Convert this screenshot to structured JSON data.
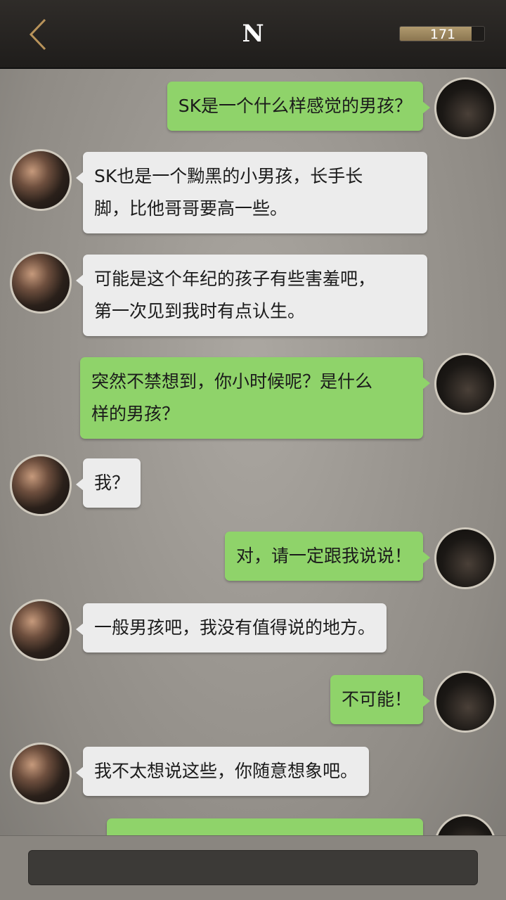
{
  "header": {
    "title": "N",
    "counter_value": "171",
    "counter_progress": 0.85,
    "back_icon": "chevron-left-icon",
    "accent_color": "#b8935a"
  },
  "messages": [
    {
      "side": "me",
      "lines": [
        "SK是一个什么样感觉的男孩？"
      ]
    },
    {
      "side": "other",
      "lines": [
        "SK也是一个黝黑的小男孩，长手长",
        "脚，比他哥哥要高一些。"
      ]
    },
    {
      "side": "other",
      "lines": [
        "可能是这个年纪的孩子有些害羞吧，",
        "第一次见到我时有点认生。"
      ]
    },
    {
      "side": "me",
      "lines": [
        "突然不禁想到，你小时候呢？是什么",
        "样的男孩？"
      ]
    },
    {
      "side": "other",
      "lines": [
        "我？"
      ]
    },
    {
      "side": "me",
      "lines": [
        "对，请一定跟我说说！"
      ]
    },
    {
      "side": "other",
      "lines": [
        "一般男孩吧，我没有值得说的地方。"
      ]
    },
    {
      "side": "me",
      "lines": [
        "不可能！"
      ]
    },
    {
      "side": "other",
      "lines": [
        "我不太想说这些，你随意想象吧。"
      ]
    },
    {
      "side": "me",
      "lines": [
        ""
      ]
    }
  ],
  "colors": {
    "my_bubble": "#8fd36a",
    "their_bubble": "#ececec"
  },
  "input": {
    "placeholder": ""
  }
}
